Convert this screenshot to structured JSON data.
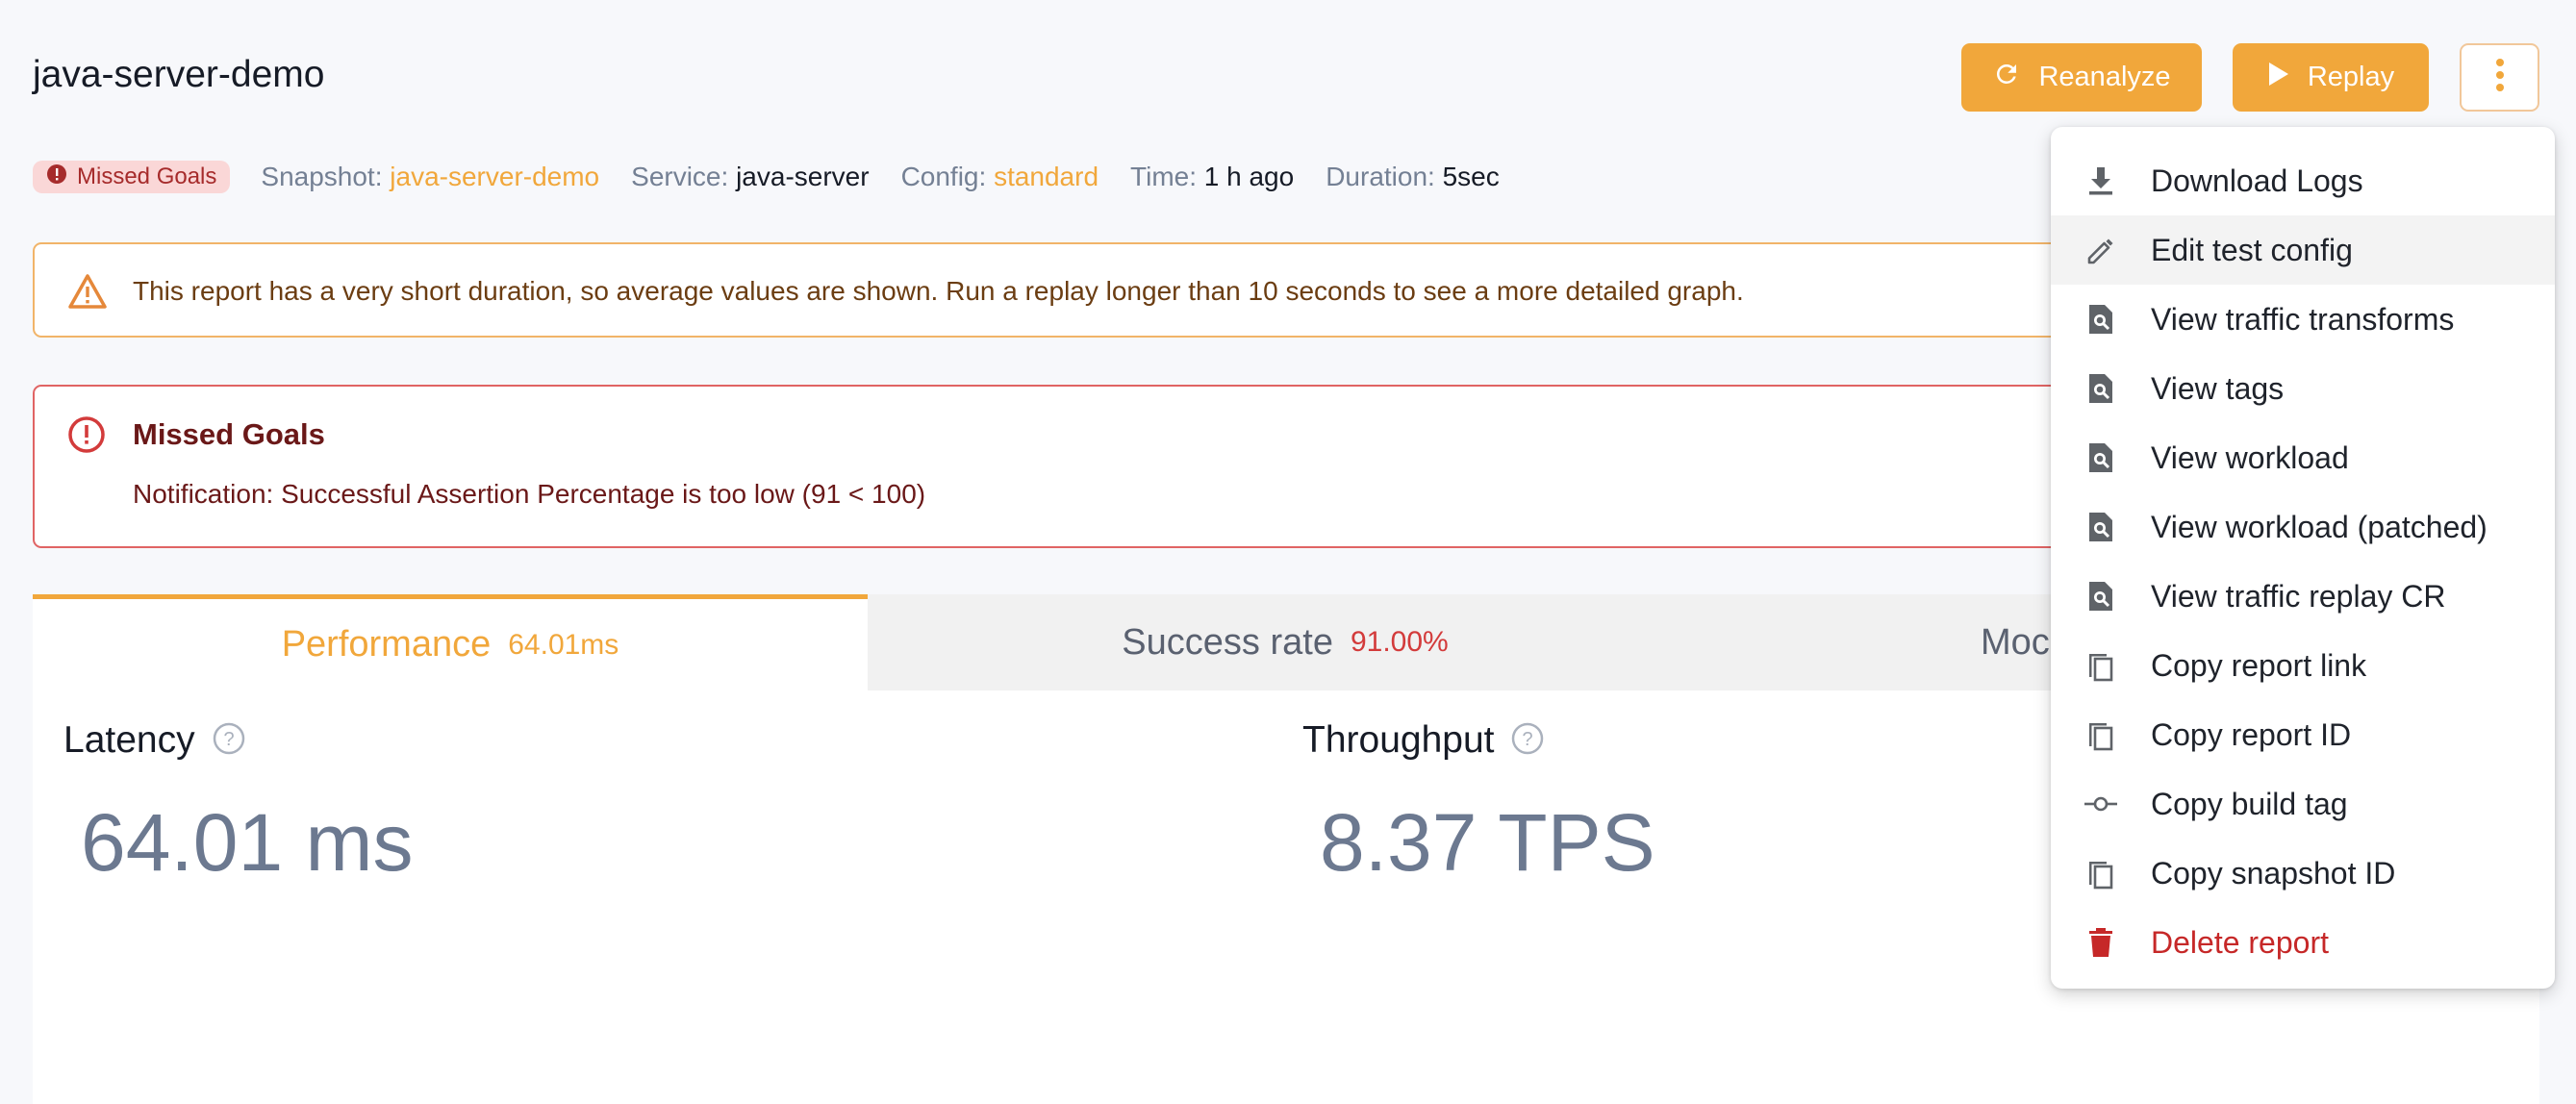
{
  "header": {
    "title": "java-server-demo",
    "reanalyze_label": "Reanalyze",
    "replay_label": "Replay"
  },
  "meta": {
    "status_badge": "Missed Goals",
    "snapshot_key": "Snapshot:",
    "snapshot_val": "java-server-demo",
    "service_key": "Service:",
    "service_val": "java-server",
    "config_key": "Config:",
    "config_val": "standard",
    "time_key": "Time:",
    "time_val": "1 h ago",
    "duration_key": "Duration:",
    "duration_val": "5sec"
  },
  "warning": {
    "text": "This report has a very short duration, so average values are shown. Run a replay longer than 10 seconds to see a more detailed graph."
  },
  "error": {
    "title": "Missed Goals",
    "message": "Notification: Successful Assertion Percentage is too low (91 < 100)"
  },
  "tabs": [
    {
      "label": "Performance",
      "value": "64.01ms",
      "active": true
    },
    {
      "label": "Success rate",
      "value": "91.00%",
      "active": false
    },
    {
      "label": "Mock re",
      "value": "",
      "active": false
    }
  ],
  "metrics": {
    "latency_title": "Latency",
    "latency_value": "64.01 ms",
    "throughput_title": "Throughput",
    "throughput_value": "8.37 TPS"
  },
  "menu": {
    "items": [
      {
        "label": "Download Logs",
        "icon": "download-icon"
      },
      {
        "label": "Edit test config",
        "icon": "pencil-icon"
      },
      {
        "label": "View traffic transforms",
        "icon": "file-search-icon"
      },
      {
        "label": "View tags",
        "icon": "file-search-icon"
      },
      {
        "label": "View workload",
        "icon": "file-search-icon"
      },
      {
        "label": "View workload (patched)",
        "icon": "file-search-icon"
      },
      {
        "label": "View traffic replay CR",
        "icon": "file-search-icon"
      },
      {
        "label": "Copy report link",
        "icon": "copy-icon"
      },
      {
        "label": "Copy report ID",
        "icon": "copy-icon"
      },
      {
        "label": "Copy build tag",
        "icon": "commit-icon"
      },
      {
        "label": "Copy snapshot ID",
        "icon": "copy-icon"
      },
      {
        "label": "Delete report",
        "icon": "trash-icon"
      }
    ]
  },
  "colors": {
    "accent": "#f1a73b",
    "danger": "#c62828",
    "muted": "#748094"
  }
}
